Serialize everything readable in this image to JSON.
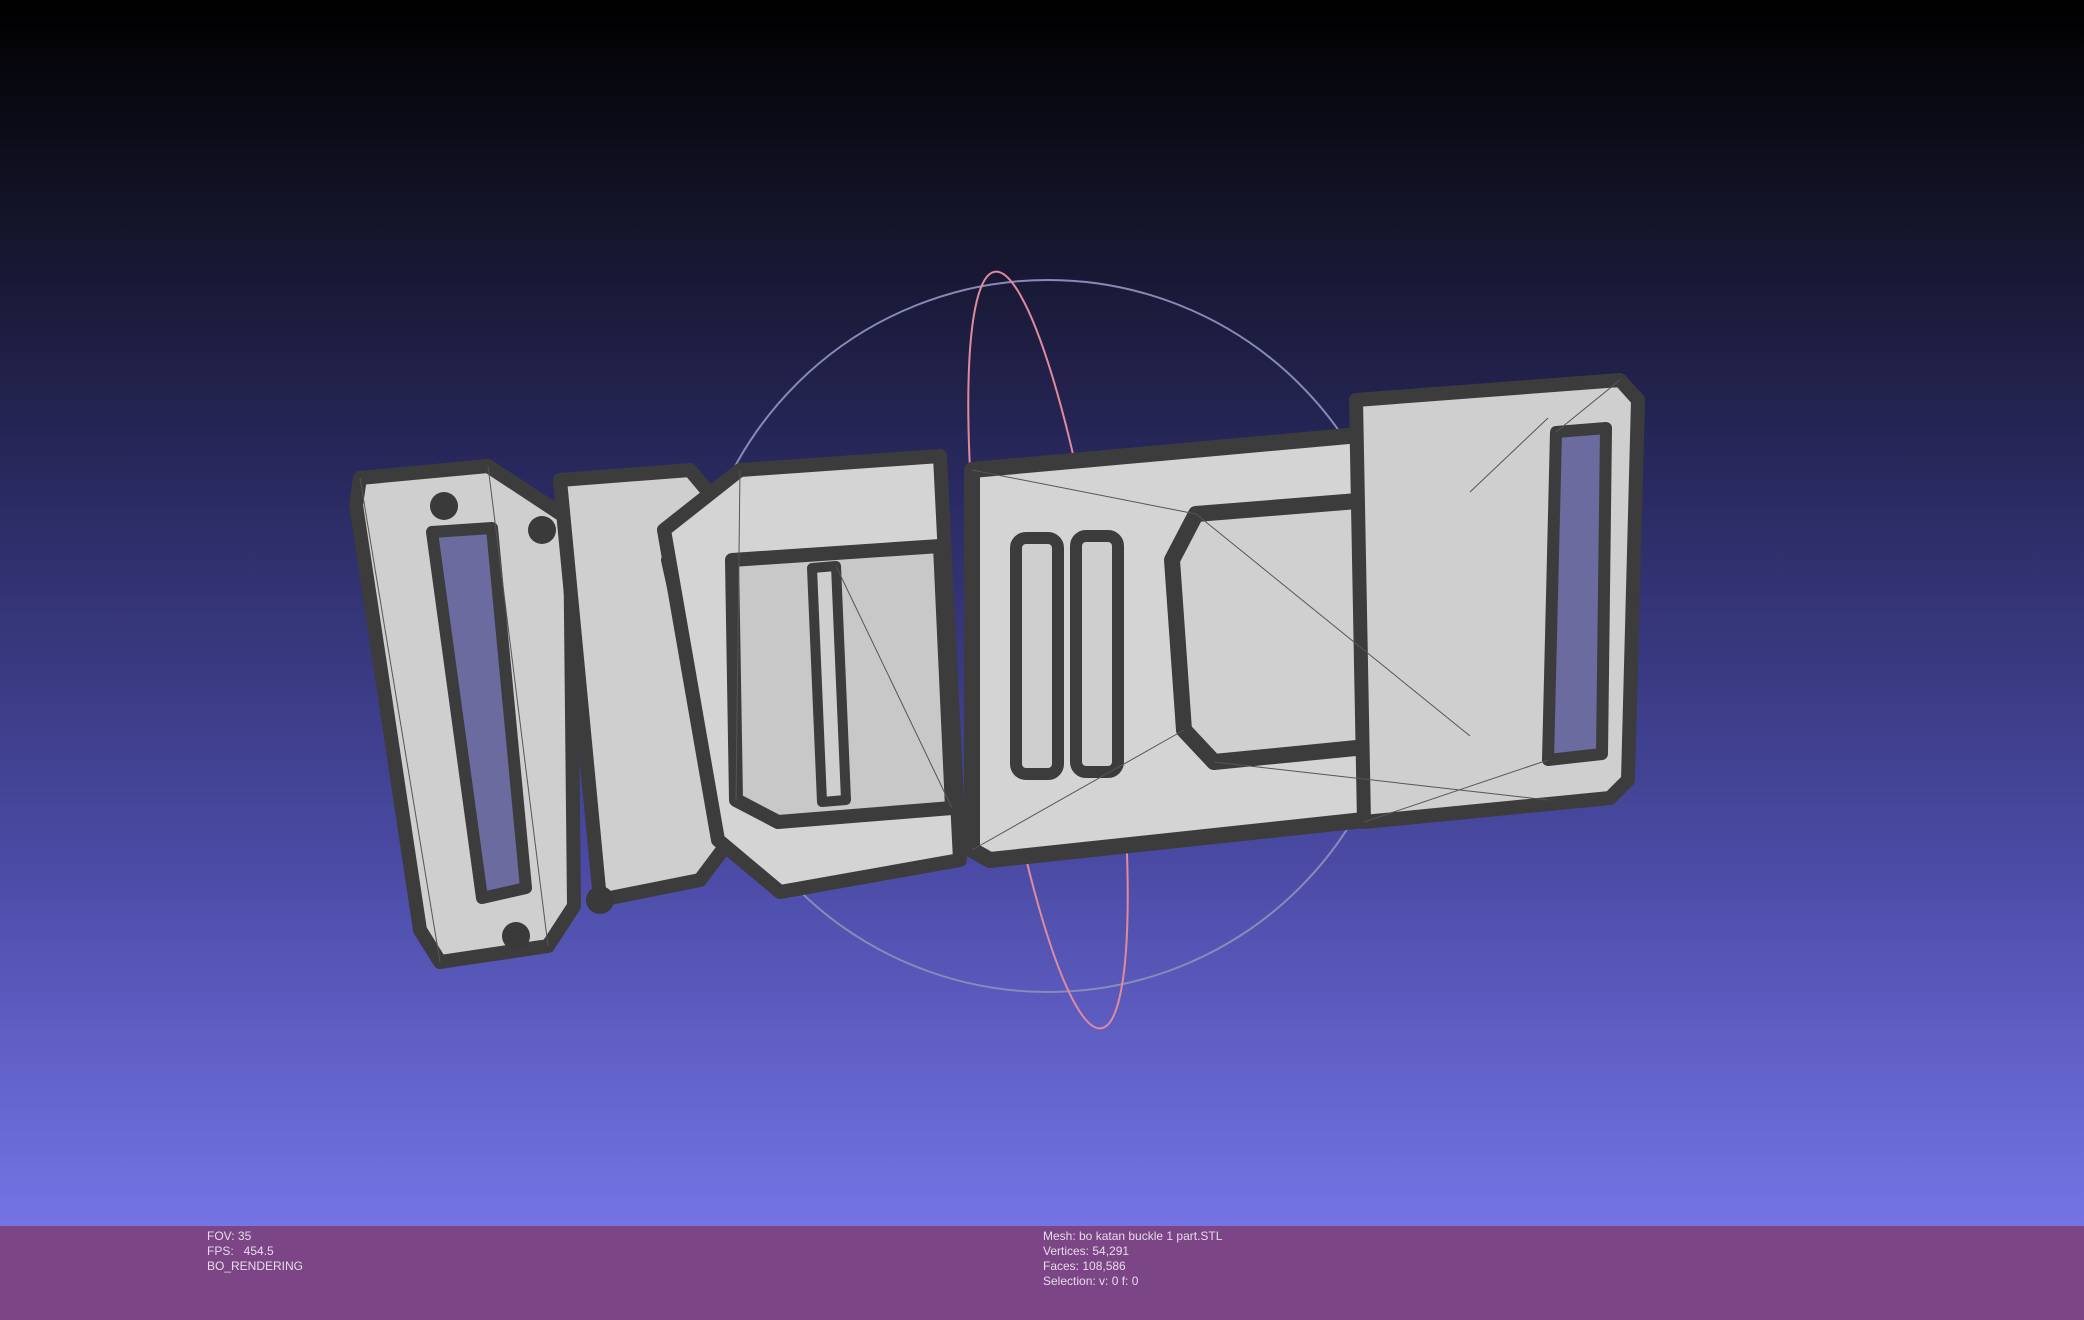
{
  "viewer": {
    "background_top": "#000000",
    "background_bottom": "#7474e6",
    "mesh_color": "#cfcfcf",
    "edge_color": "#3c3c3c",
    "trackball_colors": {
      "x": "#e08a9a",
      "y": "#90e090",
      "z": "#8a8ab8"
    }
  },
  "status_bar": {
    "color": "#7c4585",
    "left": {
      "fov": "FOV: 35",
      "fps": "FPS:   454.5",
      "mode": "BO_RENDERING"
    },
    "right": {
      "mesh": "Mesh: bo katan buckle 1 part.STL",
      "vertices": "Vertices: 54,291",
      "faces": "Faces: 108,586",
      "selection": "Selection: v: 0 f: 0"
    }
  }
}
